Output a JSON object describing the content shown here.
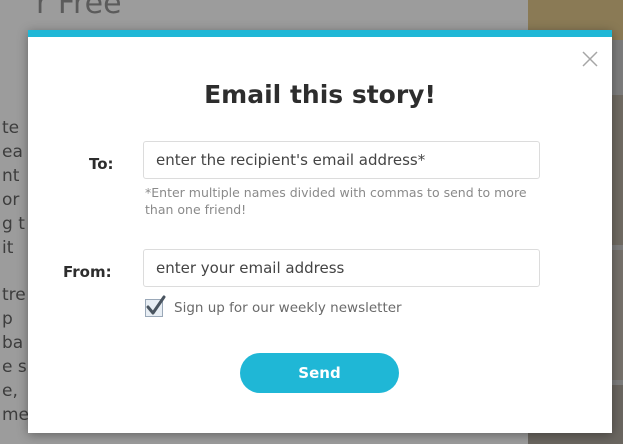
{
  "background": {
    "heading_fragment": "r Free",
    "text_fragments": [
      "te",
      "ea",
      "nt",
      "or",
      "g t",
      "it",
      "",
      "tre",
      "p",
      "ba",
      "e s",
      "e,",
      "me"
    ]
  },
  "modal": {
    "title": "Email this story!",
    "to_label": "To:",
    "to_placeholder": "enter the recipient's email address*",
    "to_hint": "*Enter multiple names divided with commas to send to more than one friend!",
    "from_label": "From:",
    "from_placeholder": "enter your email address",
    "newsletter_label": "Sign up for our weekly newsletter",
    "newsletter_checked": true,
    "send_label": "Send"
  },
  "colors": {
    "accent": "#1fb7d6",
    "title": "#2d2d2d",
    "hint": "#8a8a8a"
  },
  "icons": {
    "close": "close-icon",
    "check": "checkmark-icon"
  }
}
